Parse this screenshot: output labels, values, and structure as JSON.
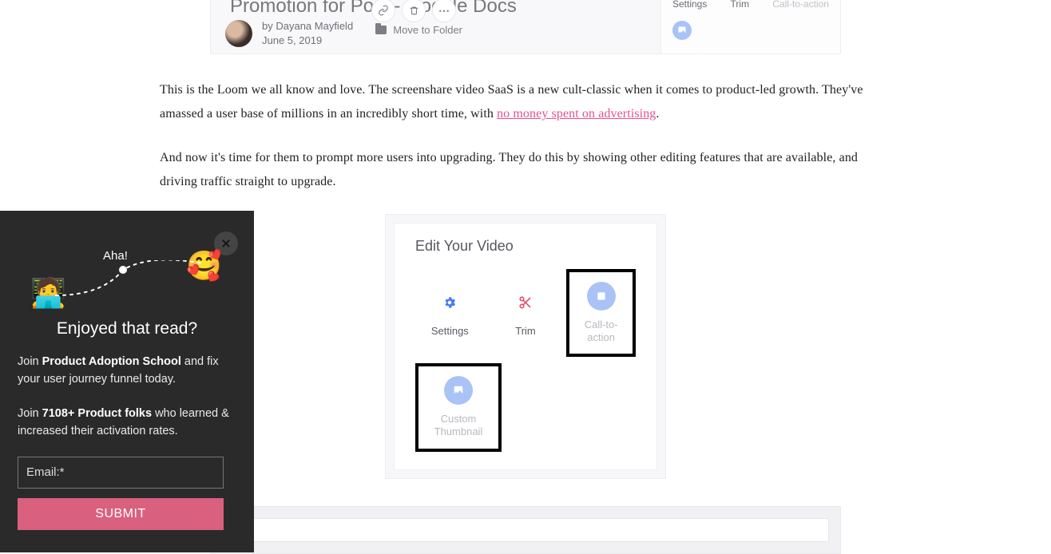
{
  "loom_preview": {
    "title_partial": "Promotion for Post - Google Docs",
    "author": "by Dayana Mayfield",
    "date": "June 5, 2019",
    "move_folder": "Move to Folder",
    "tabs": {
      "settings": "Settings",
      "trim": "Trim",
      "cta": "Call-to-action"
    }
  },
  "article": {
    "p1a": "This is the Loom we all know and love. The screenshare video SaaS is a new cult-classic when it comes to product-led growth. They've amassed a user base of millions in an incredibly short time, with ",
    "p1_link": "no money spent on advertising",
    "p1b": ".",
    "p2": "And now it's time for them to prompt more users into upgrading. They do this by showing other editing features that are available, and driving traffic straight to upgrade."
  },
  "figure": {
    "title": "Edit Your Video",
    "tiles": {
      "settings": "Settings",
      "trim": "Trim",
      "cta": "Call-to-action",
      "thumb": "Custom Thumbnail"
    }
  },
  "popup": {
    "aha": "Aha!",
    "title": "Enjoyed that read?",
    "line1a": "Join ",
    "line1b": "Product Adoption School",
    "line1c": " and fix your user journey funnel today.",
    "line2a": "Join ",
    "line2b": "7108+ Product folks",
    "line2c": " who learned & increased their activation rates.",
    "email_placeholder": "Email:*",
    "submit": "SUBMIT"
  }
}
